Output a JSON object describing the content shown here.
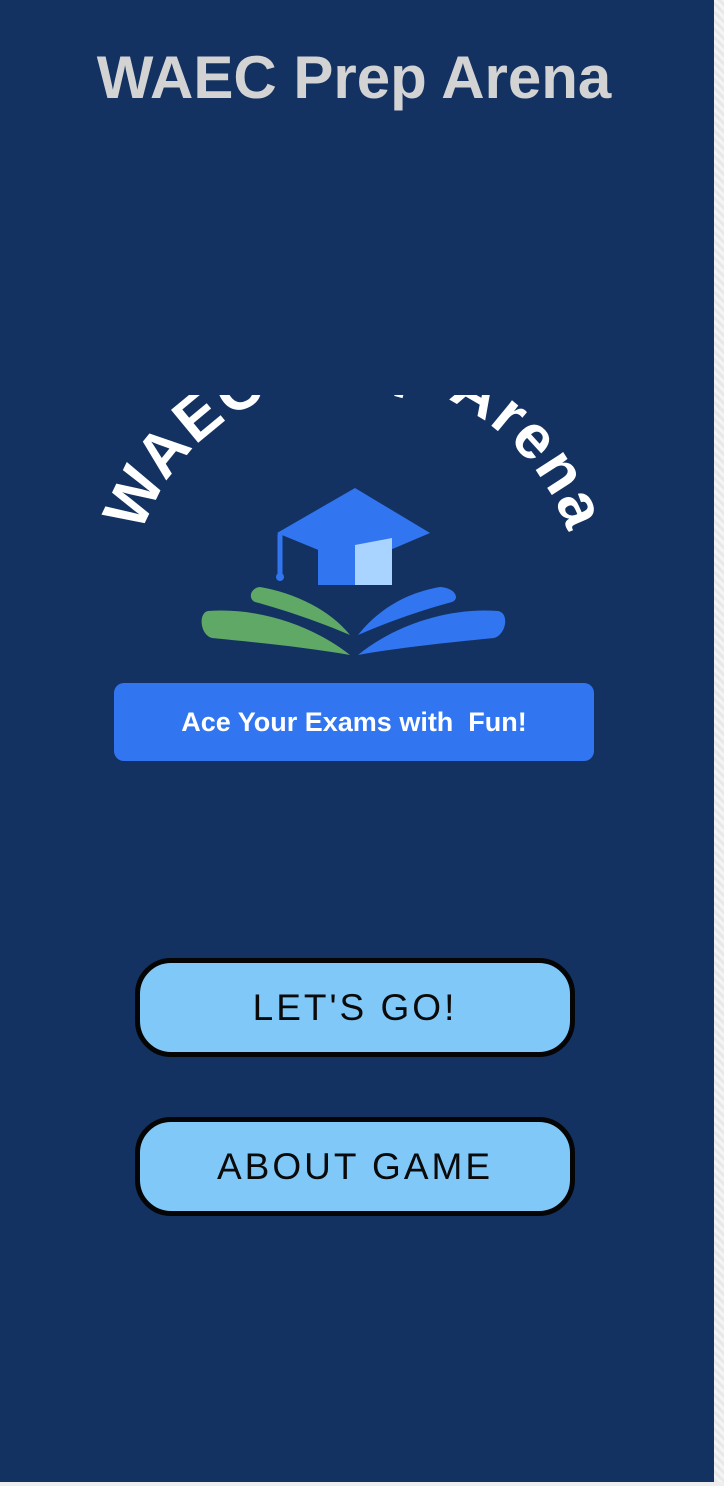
{
  "header": {
    "title": "WAEC Prep Arena"
  },
  "logo": {
    "arc_text": "WAEC Prep Arena",
    "tagline": "Ace Your Exams with  Fun!",
    "icon": "graduation-cap-book-icon",
    "colors": {
      "cap": "#3175f0",
      "cap_highlight": "#a9d4ff",
      "book_left": "#5fa866",
      "book_right": "#3175f0",
      "tagline_bg": "#3175f0"
    }
  },
  "actions": {
    "start_label": "LET'S GO!",
    "about_label": "ABOUT GAME"
  },
  "colors": {
    "background": "#133261",
    "title_text": "#d3d3d3",
    "button_bg": "#80c8f8",
    "button_border": "#050505"
  }
}
